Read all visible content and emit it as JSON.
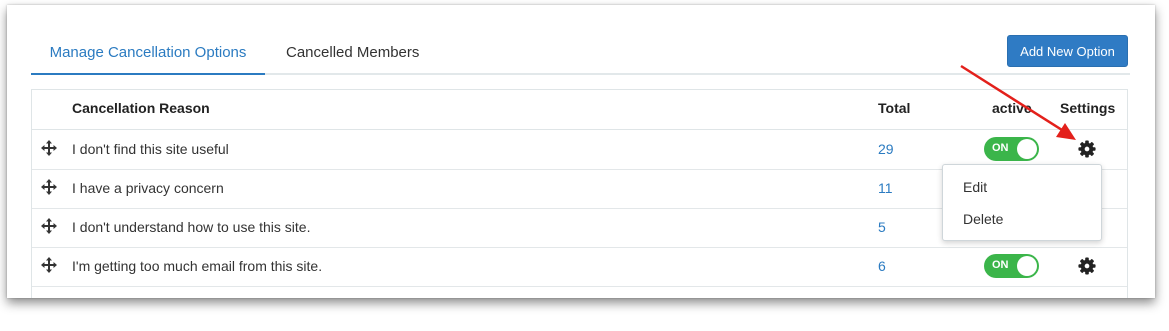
{
  "tabs": [
    {
      "label": "Manage Cancellation Options"
    },
    {
      "label": "Cancelled Members"
    }
  ],
  "add_button_label": "Add New Option",
  "table": {
    "headers": {
      "reason": "Cancellation Reason",
      "total": "Total",
      "active": "active",
      "settings": "Settings"
    },
    "rows": [
      {
        "reason": "I don't find this site useful",
        "total": "29",
        "active": "ON"
      },
      {
        "reason": "I have a privacy concern",
        "total": "11"
      },
      {
        "reason": "I don't understand how to use this site.",
        "total": "5"
      },
      {
        "reason": "I'm getting too much email from this site.",
        "total": "6",
        "active": "ON"
      }
    ]
  },
  "settings_menu": {
    "items": [
      {
        "label": "Edit"
      },
      {
        "label": "Delete"
      }
    ]
  },
  "colors": {
    "accent": "#2b7bc1",
    "toggle_on": "#3bb54a",
    "annotation_arrow": "#e3201b"
  },
  "icons": {
    "drag": "move-icon",
    "settings": "gear-icon"
  }
}
